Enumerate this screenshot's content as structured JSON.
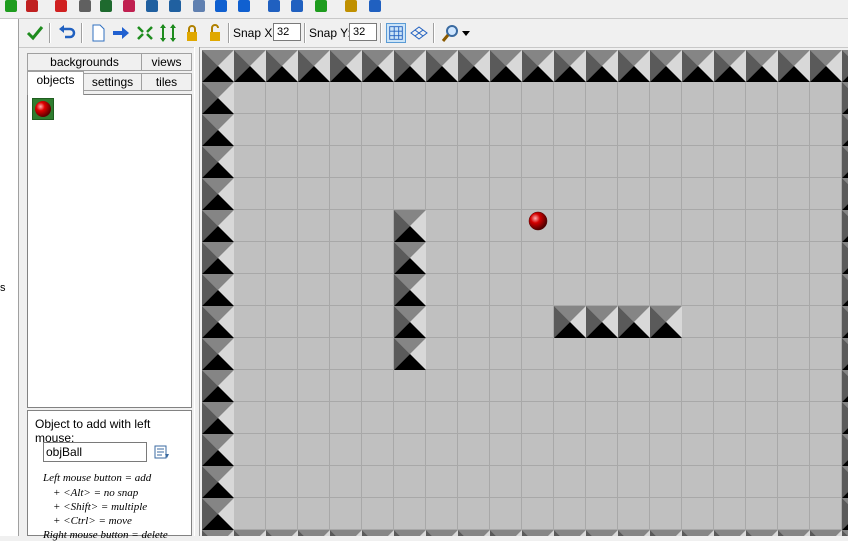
{
  "main_toolbar": {
    "icons": [
      "run-green-icon",
      "run-red-icon",
      "sprite-icon",
      "sound-icon",
      "background-icon",
      "path-icon",
      "script-icon",
      "font-icon",
      "timeline-icon",
      "object-icon",
      "room-icon",
      "game-info-icon",
      "global-settings-icon",
      "extension-icon",
      "debug-icon",
      "help-icon"
    ]
  },
  "outer_letter": "s",
  "room_toolbar": {
    "buttons": [
      "ok-checkmark-icon",
      "undo-icon",
      "clear-icon",
      "shift-icon",
      "shift-horizontal-icon",
      "shift-vertical-icon",
      "lock-icon",
      "unlock-icon"
    ],
    "snap_x_label": "Snap X:",
    "snap_x_value": "32",
    "snap_y_label": "Snap Y:",
    "snap_y_value": "32",
    "grid_toggle": "grid-icon",
    "isometric_toggle": "isometric-icon",
    "zoom": "zoom-icon"
  },
  "left_panel": {
    "tabs_back": [
      "backgrounds",
      "views"
    ],
    "tabs_front": [
      "objects",
      "settings",
      "tiles"
    ],
    "active_tab": "objects",
    "selected_object_icon": "red-ball-icon",
    "add_label": "Object to add with left mouse:",
    "object_name": "objBall",
    "help_lines": [
      "Left mouse button = add",
      "+ <Alt> = no snap",
      "+ <Shift> = multiple",
      "+ <Ctrl> = move",
      "Right mouse button = delete"
    ]
  },
  "room": {
    "grid_size": 32,
    "colors": {
      "floor": "#c0c0c0",
      "grid_line": "#a8a8a8",
      "wall_light": "#9a9a9a",
      "wall_dark": "#000000",
      "ball": "#d40000"
    },
    "walls_inner": [
      {
        "col": 6,
        "row": 5
      },
      {
        "col": 6,
        "row": 6
      },
      {
        "col": 6,
        "row": 7
      },
      {
        "col": 6,
        "row": 8
      },
      {
        "col": 6,
        "row": 9
      },
      {
        "col": 11,
        "row": 8
      },
      {
        "col": 12,
        "row": 8
      },
      {
        "col": 13,
        "row": 8
      },
      {
        "col": 14,
        "row": 8
      }
    ],
    "ball": {
      "col": 10,
      "row": 5
    }
  }
}
